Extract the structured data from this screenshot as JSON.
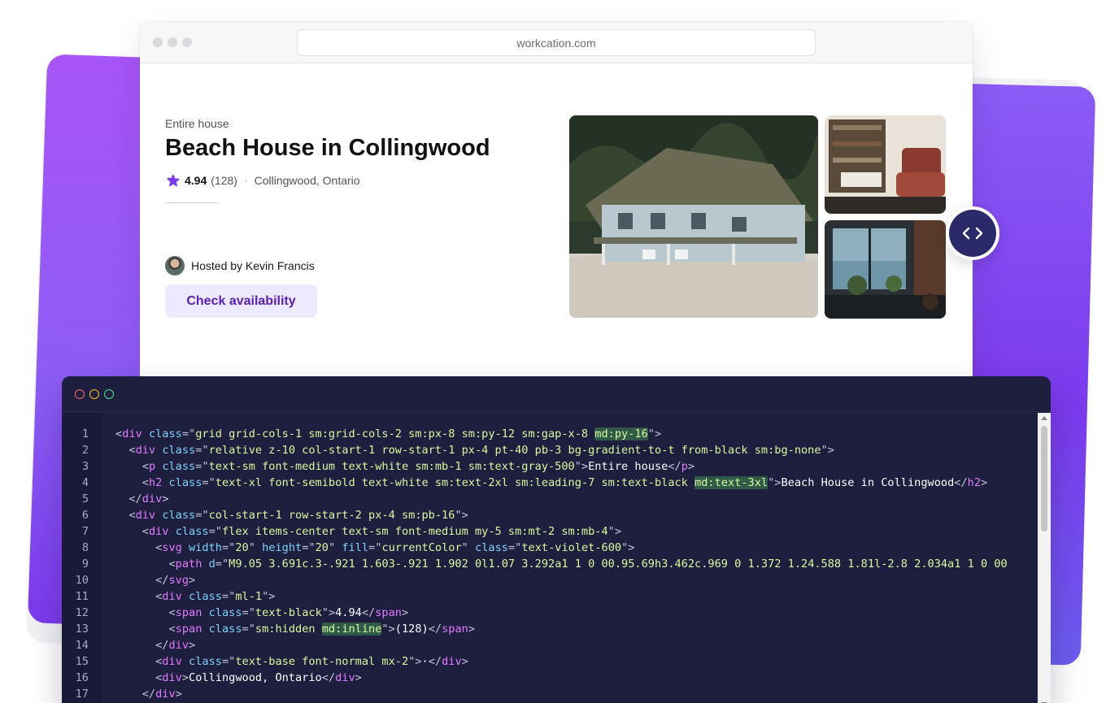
{
  "browser": {
    "url": "workcation.com"
  },
  "listing": {
    "eyebrow": "Entire house",
    "title": "Beach House in Collingwood",
    "rating": "4.94",
    "reviews": "(128)",
    "separator": "·",
    "location": "Collingwood, Ontario",
    "host": "Hosted by Kevin Francis",
    "cta": "Check availability",
    "accent_color": "#7c3aed",
    "cta_bg": "#ede9fe"
  },
  "icons": {
    "star": "star-icon",
    "code_toggle": "code-brackets-icon"
  },
  "editor": {
    "theme_bg": "#1e1e3f",
    "line_numbers": [
      "1",
      "2",
      "3",
      "4",
      "5",
      "6",
      "7",
      "8",
      "9",
      "10",
      "11",
      "12",
      "13",
      "14",
      "15",
      "16",
      "17"
    ],
    "lines": [
      "<div class=\"grid grid-cols-1 sm:grid-cols-2 sm:px-8 sm:py-12 sm:gap-x-8 md:py-16\">",
      "  <div class=\"relative z-10 col-start-1 row-start-1 px-4 pt-40 pb-3 bg-gradient-to-t from-black sm:bg-none\">",
      "    <p class=\"text-sm font-medium text-white sm:mb-1 sm:text-gray-500\">Entire house</p>",
      "    <h2 class=\"text-xl font-semibold text-white sm:text-2xl sm:leading-7 sm:text-black md:text-3xl\">Beach House in Collingwood</h2>",
      "  </div>",
      "  <div class=\"col-start-1 row-start-2 px-4 sm:pb-16\">",
      "    <div class=\"flex items-center text-sm font-medium my-5 sm:mt-2 sm:mb-4\">",
      "      <svg width=\"20\" height=\"20\" fill=\"currentColor\" class=\"text-violet-600\">",
      "        <path d=\"M9.05 3.691c.3-.921 1.603-.921 1.902 0l1.07 3.292a1 1 0 00.95.69h3.462c.969 0 1.372 1.24.588 1.81l-2.8 2.034a1 1 0 00-",
      "      </svg>",
      "      <div class=\"ml-1\">",
      "        <span class=\"text-black\">4.94</span>",
      "        <span class=\"sm:hidden md:inline\">(128)</span>",
      "      </div>",
      "      <div class=\"text-base font-normal mx-2\">·</div>",
      "      <div>Collingwood, Ontario</div>",
      "    </div>"
    ]
  }
}
